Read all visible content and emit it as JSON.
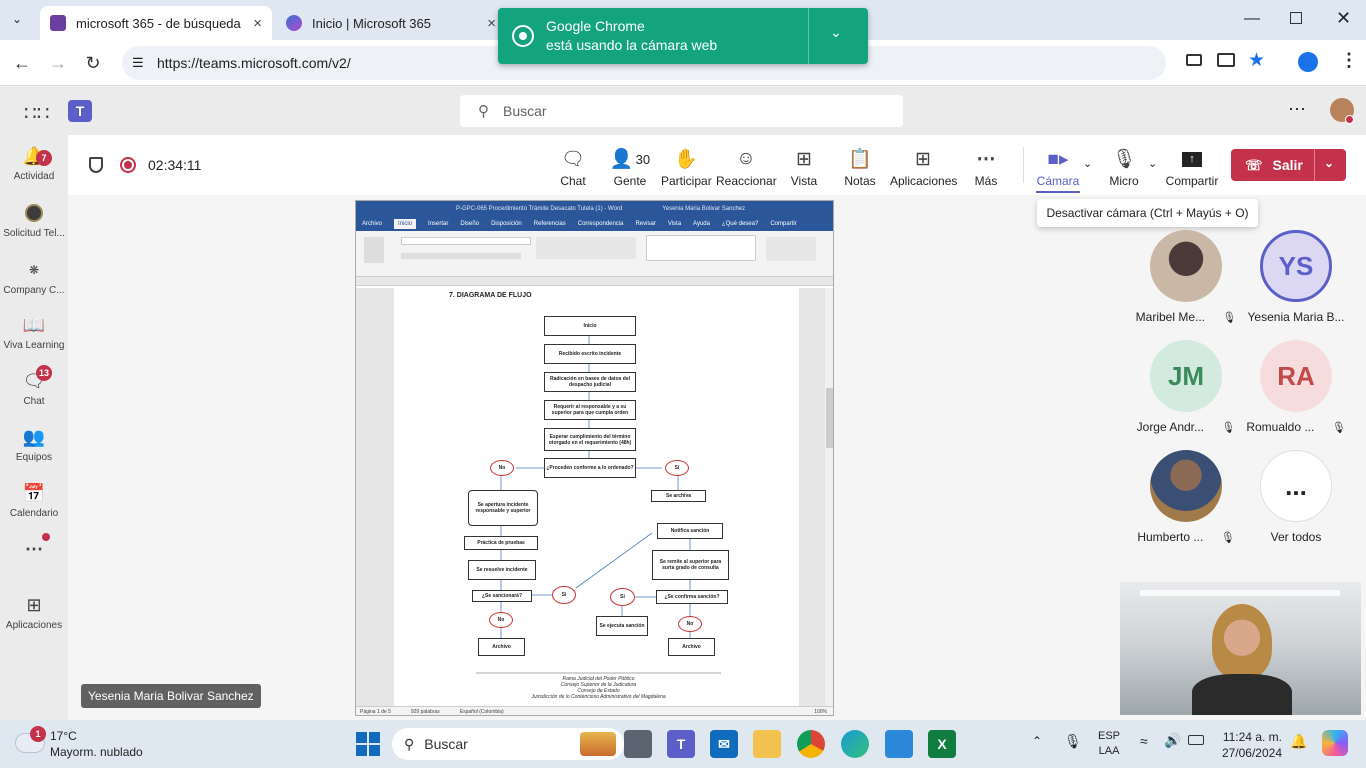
{
  "browser": {
    "tabs": [
      {
        "title": "microsoft 365 - de búsqueda",
        "color": "#6b3fa0"
      },
      {
        "title": "Inicio | Microsoft 365",
        "color": "#3b6fd6"
      }
    ],
    "url": "https://teams.microsoft.com/v2/",
    "toast": {
      "line1": "Google Chrome",
      "line2": "está usando la cámara web"
    }
  },
  "teams": {
    "search_placeholder": "Buscar",
    "rail": [
      {
        "label": "Actividad",
        "icon": "bell-icon",
        "badge": "7"
      },
      {
        "label": "Solicitud Tel...",
        "icon": "app-icon"
      },
      {
        "label": "Company C...",
        "icon": "app-icon"
      },
      {
        "label": "Viva Learning",
        "icon": "book-icon"
      },
      {
        "label": "Chat",
        "icon": "chat-icon",
        "badge": "13"
      },
      {
        "label": "Equipos",
        "icon": "teams-icon"
      },
      {
        "label": "Calendario",
        "icon": "calendar-icon"
      },
      {
        "label": "Aplicaciones",
        "icon": "plus-icon"
      }
    ],
    "timer": "02:34:11",
    "toolbar": {
      "chat": "Chat",
      "people": "Gente",
      "people_count": "30",
      "raise": "Participar",
      "react": "Reaccionar",
      "view": "Vista",
      "notes": "Notas",
      "apps": "Aplicaciones",
      "more": "Más",
      "camera": "Cámara",
      "mic": "Micro",
      "share": "Compartir",
      "leave": "Salir"
    },
    "tooltip": "Desactivar cámara (Ctrl + Mayús + O)",
    "presenter_name": "Yesenia Maria Bolivar Sanchez",
    "participants": [
      {
        "name": "Maribel Me...",
        "initials": "",
        "photo": true
      },
      {
        "name": "Yesenia Maria B...",
        "initials": "YS"
      },
      {
        "name": "Jorge Andr...",
        "initials": "JM"
      },
      {
        "name": "Romualdo ...",
        "initials": "RA"
      },
      {
        "name": "Humberto ...",
        "initials": "",
        "photo": true
      },
      {
        "name": "Ver todos",
        "initials": "..."
      }
    ]
  },
  "document": {
    "title": "P-GPC-065 Procedimiento Trámite Desacato Tutela (1) - Word",
    "user": "Yesenia Maria Bolivar Sanchez",
    "ribbon_tabs": [
      "Archivo",
      "Inicio",
      "Insertar",
      "Diseño",
      "Disposición",
      "Referencias",
      "Correspondencia",
      "Revisar",
      "Vista",
      "Ayuda",
      "¿Qué desea?",
      "Compartir"
    ],
    "section": "7.   DIAGRAMA DE FLUJO",
    "status": [
      "Página 1 de 5",
      "929 palabras",
      "Español (Colombia)",
      "100%"
    ],
    "footer": [
      "Rama Judicial del Poder Público",
      "Consejo Superior de la Judicatura",
      "Consejo de Estado",
      "Jurisdicción de lo Contencioso Administrativo del Magdalena"
    ],
    "flow": {
      "inicio": "Inicio",
      "n1": "Recibido escrito incidente",
      "n2": "Radicación en bases de datos del despacho judicial",
      "n3": "Requerir al responsable y a su superior para que cumpla orden",
      "n4": "Esperar cumplimiento del término otorgado en el requerimiento (48h)",
      "n5": "¿Proceden conforme a lo ordenado?",
      "no1": "No",
      "si1": "Si",
      "archiva": "Se archiva",
      "apertura": "Se apertura incidente responsable y superior",
      "pruebas": "Práctica de pruebas",
      "resuelve": "Se resuelve incidente",
      "sanciona": "¿Se sancionará?",
      "si2": "Si",
      "no2": "No",
      "archivo1": "Archivo",
      "notifica": "Notifica sanción",
      "remite": "Se remite al superior para surta grado de consulta",
      "confirma": "¿Se confirma sanción?",
      "si3": "Si",
      "no3": "No",
      "ejecuta": "Se ejecuta sanción",
      "archivo2": "Archivo"
    }
  },
  "taskbar": {
    "weather_temp": "17°C",
    "weather_desc": "Mayorm. nublado",
    "weather_badge": "1",
    "search": "Buscar",
    "lang1": "ESP",
    "lang2": "LAA",
    "time": "11:24 a. m.",
    "date": "27/06/2024"
  }
}
